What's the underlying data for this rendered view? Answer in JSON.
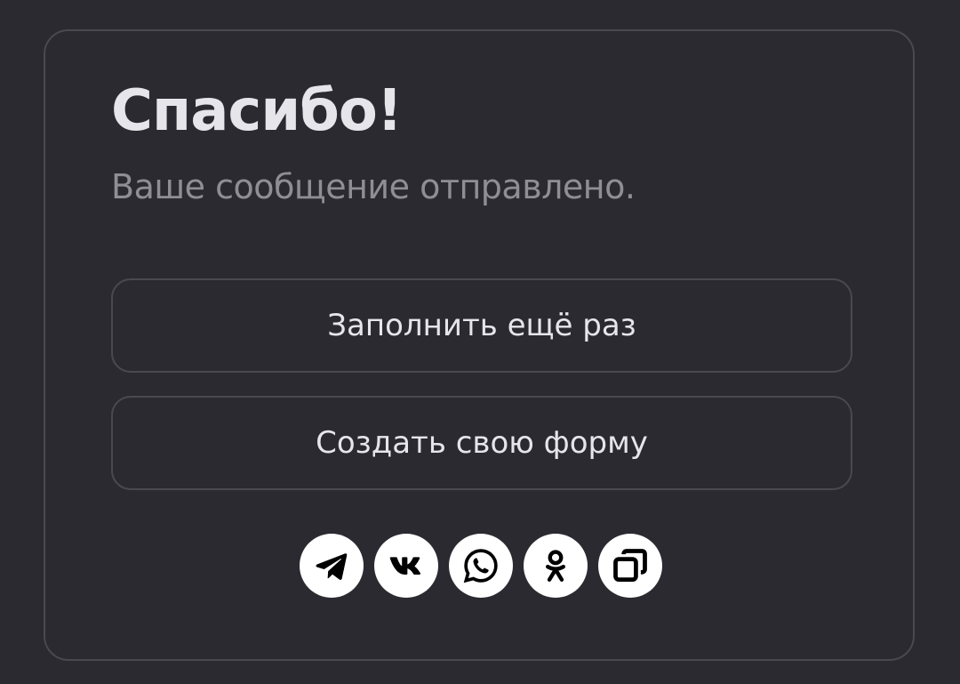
{
  "card": {
    "title": "Спасибо!",
    "subtitle": "Ваше сообщение отправлено."
  },
  "actions": {
    "fill_again_label": "Заполнить ещё раз",
    "create_form_label": "Создать свою форму"
  },
  "share": {
    "icons": [
      "telegram-icon",
      "vk-icon",
      "whatsapp-icon",
      "odnoklassniki-icon",
      "copy-link-icon"
    ]
  },
  "colors": {
    "background": "#2b2a30",
    "border": "#4a4950",
    "text_primary": "#e6e5ea",
    "text_secondary": "#8f8e95",
    "share_button_bg": "#ffffff",
    "share_icon": "#000000"
  }
}
